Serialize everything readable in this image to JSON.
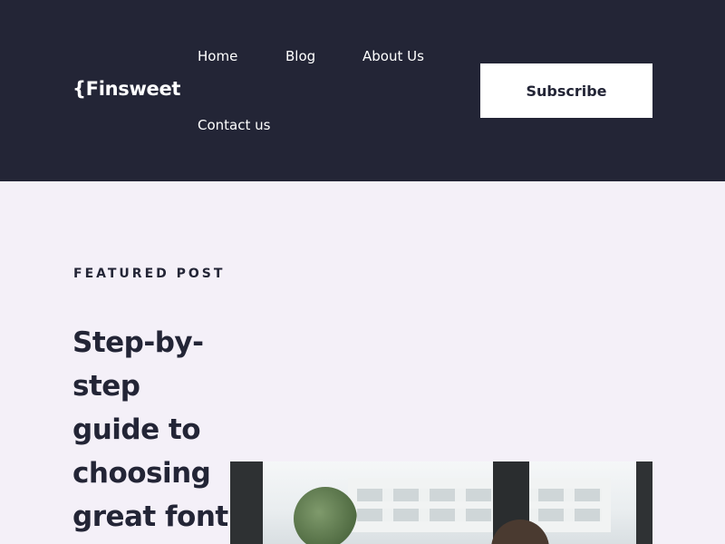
{
  "header": {
    "logo": "{Finsweet",
    "nav": {
      "home": "Home",
      "blog": "Blog",
      "about": "About Us",
      "contact": "Contact us"
    },
    "subscribe_label": "Subscribe"
  },
  "featured": {
    "label": "FEATURED POST",
    "title": "Step-by-step guide to choosing great font"
  },
  "colors": {
    "header_bg": "#232536",
    "page_bg": "#f4f0f8",
    "text_dark": "#232536",
    "button_bg": "#ffffff"
  }
}
